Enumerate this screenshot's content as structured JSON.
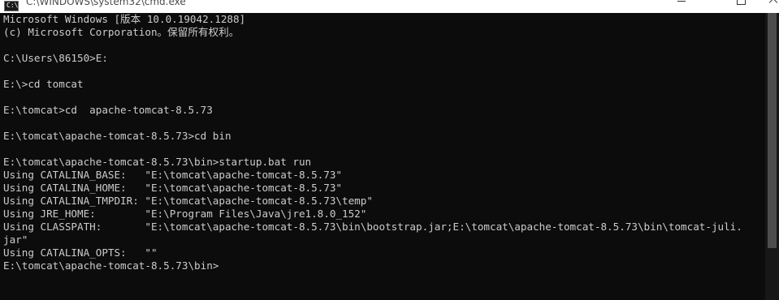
{
  "window": {
    "title": "C:\\WINDOWS\\system32\\cmd.exe",
    "icon_label": "C:\\"
  },
  "console": {
    "lines": [
      "Microsoft Windows [版本 10.0.19042.1288]",
      "(c) Microsoft Corporation。保留所有权利。",
      "",
      "C:\\Users\\86150>E:",
      "",
      "E:\\>cd tomcat",
      "",
      "E:\\tomcat>cd  apache-tomcat-8.5.73",
      "",
      "E:\\tomcat\\apache-tomcat-8.5.73>cd bin",
      "",
      "E:\\tomcat\\apache-tomcat-8.5.73\\bin>startup.bat run",
      "Using CATALINA_BASE:   \"E:\\tomcat\\apache-tomcat-8.5.73\"",
      "Using CATALINA_HOME:   \"E:\\tomcat\\apache-tomcat-8.5.73\"",
      "Using CATALINA_TMPDIR: \"E:\\tomcat\\apache-tomcat-8.5.73\\temp\"",
      "Using JRE_HOME:        \"E:\\Program Files\\Java\\jre1.8.0_152\"",
      "Using CLASSPATH:       \"E:\\tomcat\\apache-tomcat-8.5.73\\bin\\bootstrap.jar;E:\\tomcat\\apache-tomcat-8.5.73\\bin\\tomcat-juli.",
      "jar\"",
      "Using CATALINA_OPTS:   \"\"",
      "E:\\tomcat\\apache-tomcat-8.5.73\\bin>"
    ]
  },
  "colors": {
    "console_background": "#0c0c0c",
    "console_text": "#cccccc",
    "titlebar_background": "#ffffff"
  }
}
